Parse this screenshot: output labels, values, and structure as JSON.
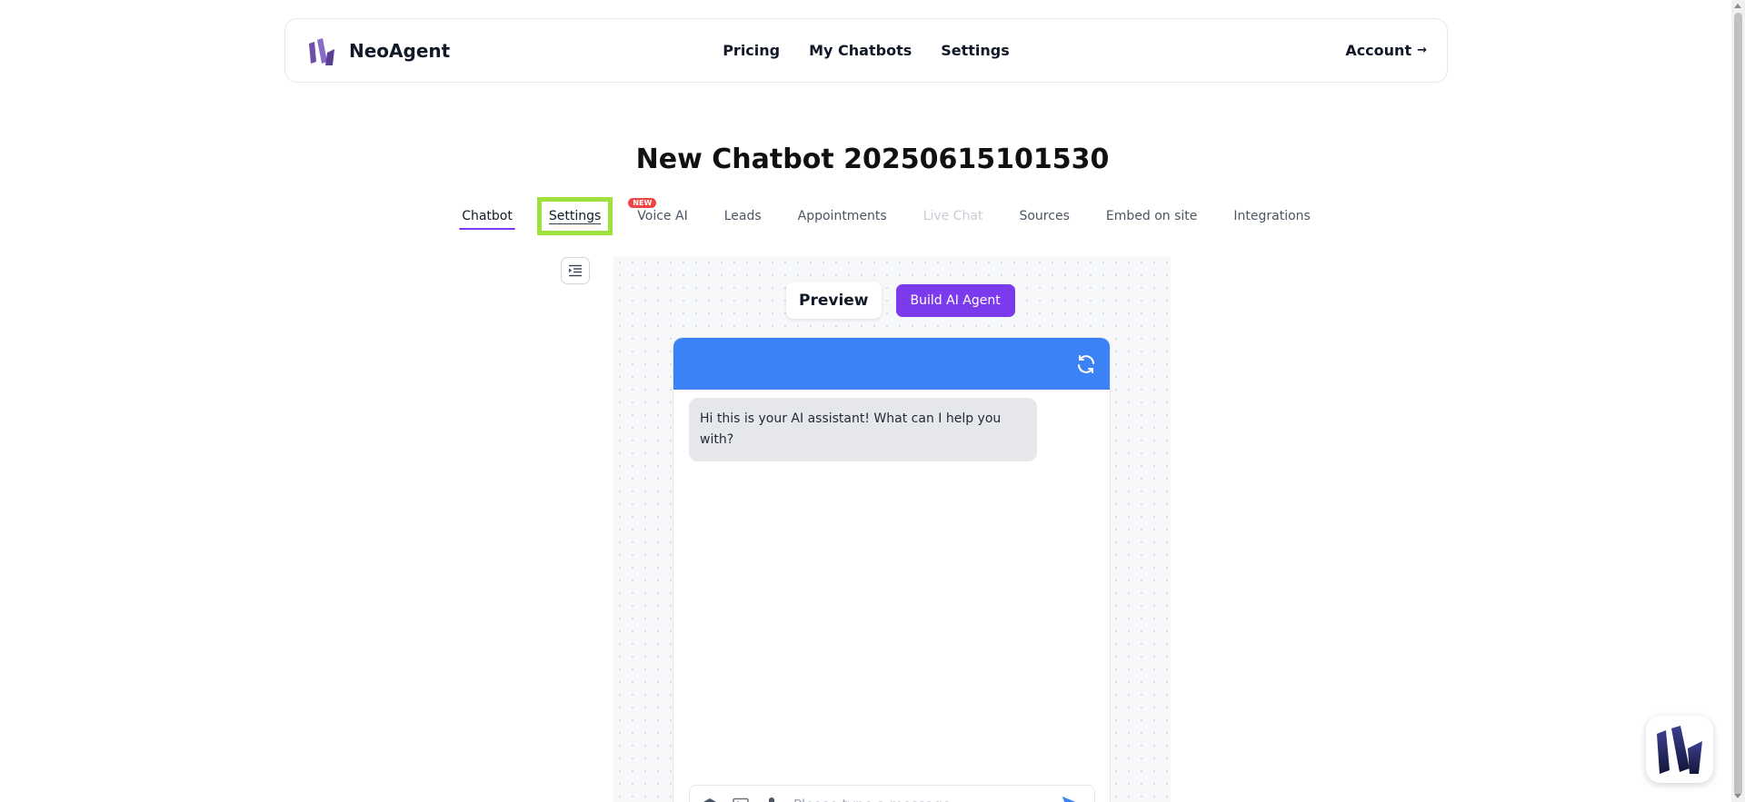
{
  "header": {
    "brand_name": "NeoAgent",
    "nav": [
      "Pricing",
      "My Chatbots",
      "Settings"
    ],
    "account_label": "Account",
    "account_arrow": "→"
  },
  "page": {
    "title": "New Chatbot 20250615101530"
  },
  "tabs": {
    "items": [
      {
        "label": "Chatbot",
        "state": "active"
      },
      {
        "label": "Settings",
        "state": "highlighted"
      },
      {
        "label": "Voice AI",
        "badge": "NEW"
      },
      {
        "label": "Leads"
      },
      {
        "label": "Appointments"
      },
      {
        "label": "Live Chat",
        "state": "disabled"
      },
      {
        "label": "Sources"
      },
      {
        "label": "Embed on site"
      },
      {
        "label": "Integrations"
      }
    ]
  },
  "preview": {
    "preview_label": "Preview",
    "build_label": "Build AI Agent"
  },
  "chat": {
    "header_color": "#3b82f6",
    "greeting": "Hi this is your AI assistant! What can I help you with?",
    "input_placeholder": "Please type a message"
  },
  "colors": {
    "accent": "#7c3aed",
    "highlight_outline": "#9ee03c",
    "badge": "#ef4444"
  },
  "icons": {
    "side_toggle": "indent-list-icon",
    "chat_refresh": "refresh-icon",
    "composer": [
      "layers-icon",
      "image-icon",
      "microphone-icon",
      "send-icon"
    ],
    "launcher": "neoagent-logo-icon"
  }
}
